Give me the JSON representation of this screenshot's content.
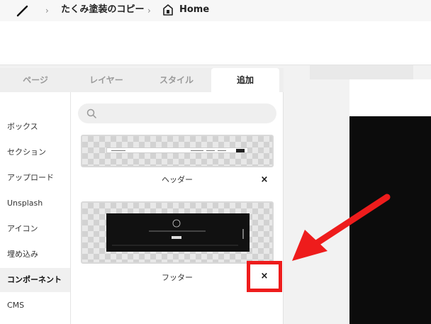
{
  "breadcrumb": {
    "project": "たくみ塗装のコピー",
    "page": "Home"
  },
  "tabs": [
    {
      "label": "ページ",
      "active": false
    },
    {
      "label": "レイヤー",
      "active": false
    },
    {
      "label": "スタイル",
      "active": false
    },
    {
      "label": "追加",
      "active": true
    }
  ],
  "side_nav": [
    {
      "label": "ボックス",
      "active": false
    },
    {
      "label": "セクション",
      "active": false
    },
    {
      "label": "アップロード",
      "active": false
    },
    {
      "label": "Unsplash",
      "active": false
    },
    {
      "label": "アイコン",
      "active": false
    },
    {
      "label": "埋め込み",
      "active": false
    },
    {
      "label": "コンポーネント",
      "active": true
    },
    {
      "label": "CMS",
      "active": false
    }
  ],
  "search": {
    "placeholder": ""
  },
  "components": [
    {
      "label": "ヘッダー",
      "close": "×"
    },
    {
      "label": "フッター",
      "close": "×"
    }
  ],
  "colors": {
    "accent_red": "#ee1c1c",
    "active_tab_bg": "#ffffff",
    "canvas_dark": "#0c0c0c"
  },
  "icons": {
    "logo": "slash-logo-icon",
    "separator": "chevron-right-icon",
    "page": "home-page-icon",
    "search": "search-icon",
    "close": "close-icon",
    "annotation": "red-arrow-icon"
  }
}
